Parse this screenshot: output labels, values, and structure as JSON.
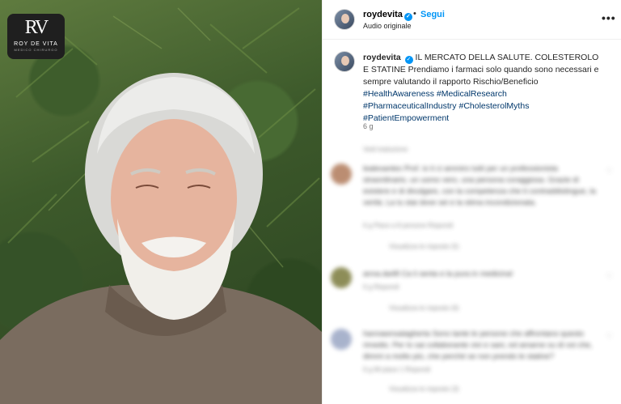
{
  "media": {
    "logo": {
      "monogram": "RV",
      "name": "ROY DE VITA",
      "subtitle": "MEDICO CHIRURGO"
    }
  },
  "header": {
    "username": "roydevita",
    "separator": "•",
    "follow_label": "Segui",
    "audio_label": "Audio originale",
    "more_label": "•••"
  },
  "caption": {
    "username": "roydevita",
    "text": "IL MERCATO DELLA SALUTE. COLESTEROLO E STATINE Prendiamo i farmaci solo quando sono necessari e sempre valutando il rapporto Rischio/Beneficio",
    "hashtags": [
      "#HealthAwareness",
      "#MedicalResearch",
      "#PharmaceuticalIndustry",
      "#CholesterolMyths",
      "#PatientEmpowerment"
    ],
    "age": "6 g"
  },
  "comments": {
    "see_translation": "Vedi traduzione",
    "items": [
      {
        "text": "lealesantes Prof. io ti ci ammiro tutti per un professionista straordinario, un uomo vero, una persona coraggiosa. Grazie di esistere e di divulgare, con la competenza che ti contraddistingue, la verità. La tu stai dove sei e la stima incondizionata.",
        "meta": "6 g   Piace a 8 persone   Rispondi",
        "replies": "Visualizza le risposte (5)",
        "heart": "♡"
      },
      {
        "text": "anna.da48 Ca li senta e la pura in medicina!",
        "meta": "6 g   Rispondi",
        "replies": "Visualizza le risposte (6)",
        "heart": "♡"
      },
      {
        "text": "hannawnsalagherta Sono tante le persone che affrontano questo rimedio. Per lo sai collaborante vivi e sani, ed amarne su di voi che, dimmi a molto più, che perché se non prendo le statine?",
        "meta": "6 g   Mi piace 1   Rispondi",
        "replies": "Visualizza le risposte (3)",
        "heart": "♡"
      }
    ]
  }
}
